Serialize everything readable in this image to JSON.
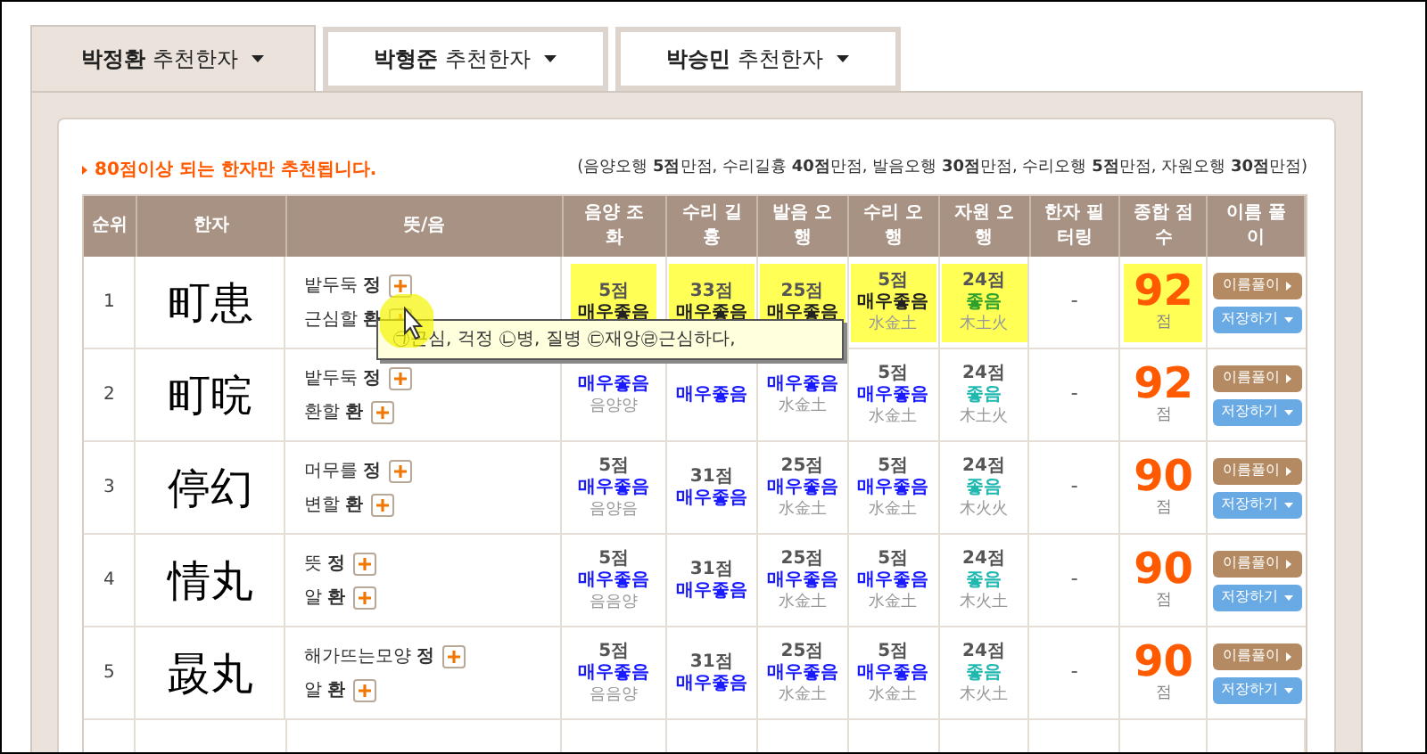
{
  "tabs": [
    {
      "name": "박정환",
      "label": "추천한자",
      "selected": true
    },
    {
      "name": "박형준",
      "label": "추천한자",
      "selected": false
    },
    {
      "name": "박승민",
      "label": "추천한자",
      "selected": false
    }
  ],
  "notice": "80점이상 되는 한자만 추천됩니다.",
  "criteria": "(음양오행 **5점**만점, 수리길흉 **40점**만점, 발음오행 **30점**만점, 수리오행 **5점**만점, 자원오행 **30점**만점)",
  "columns": [
    "순위",
    "한자",
    "뜻/음",
    "음양 조화",
    "수리 길흉",
    "발음 오행",
    "수리 오행",
    "자원 오행",
    "한자 필터링",
    "종합 점수",
    "이름 풀이"
  ],
  "rows": [
    {
      "rank": "1",
      "hanja": "町患",
      "meanings": [
        {
          "meaning": "밭두둑",
          "sound": "정"
        },
        {
          "meaning": "근심할",
          "sound": "환"
        }
      ],
      "highlighted": true,
      "scores": [
        {
          "score": "5점",
          "rating": "매우좋음",
          "kind": "best"
        },
        {
          "score": "33점",
          "rating": "매우좋음",
          "kind": "best"
        },
        {
          "score": "25점",
          "rating": "매우좋음",
          "kind": "best"
        },
        {
          "score": "5점",
          "rating": "매우좋음",
          "kind": "best",
          "sub": "水金土"
        },
        {
          "score": "24점",
          "rating": "좋음",
          "kind": "good",
          "sub": "木土火"
        }
      ],
      "filter": "-",
      "total": "92",
      "unit": "점",
      "buttons": [
        "이름풀이",
        "저장하기"
      ]
    },
    {
      "rank": "2",
      "hanja": "町晥",
      "meanings": [
        {
          "meaning": "밭두둑",
          "sound": "정"
        },
        {
          "meaning": "환할",
          "sound": "환"
        }
      ],
      "highlighted": false,
      "scores": [
        {
          "rating": "매우좋음",
          "kind": "best",
          "sub": "음양양"
        },
        {
          "rating": "매우좋음",
          "kind": "best"
        },
        {
          "rating": "매우좋음",
          "kind": "best",
          "sub": "水金土"
        },
        {
          "score": "5점",
          "rating": "매우좋음",
          "kind": "best",
          "sub": "水金土"
        },
        {
          "score": "24점",
          "rating": "좋음",
          "kind": "good",
          "sub": "木土火"
        }
      ],
      "filter": "-",
      "total": "92",
      "unit": "점",
      "buttons": [
        "이름풀이",
        "저장하기"
      ]
    },
    {
      "rank": "3",
      "hanja": "停幻",
      "meanings": [
        {
          "meaning": "머무를",
          "sound": "정"
        },
        {
          "meaning": "변할",
          "sound": "환"
        }
      ],
      "highlighted": false,
      "scores": [
        {
          "score": "5점",
          "rating": "매우좋음",
          "kind": "best",
          "sub": "음양음"
        },
        {
          "score": "31점",
          "rating": "매우좋음",
          "kind": "best"
        },
        {
          "score": "25점",
          "rating": "매우좋음",
          "kind": "best",
          "sub": "水金土"
        },
        {
          "score": "5점",
          "rating": "매우좋음",
          "kind": "best",
          "sub": "水金土"
        },
        {
          "score": "24점",
          "rating": "좋음",
          "kind": "good",
          "sub": "木火火"
        }
      ],
      "filter": "-",
      "total": "90",
      "unit": "점",
      "buttons": [
        "이름풀이",
        "저장하기"
      ]
    },
    {
      "rank": "4",
      "hanja": "情丸",
      "meanings": [
        {
          "meaning": "뜻",
          "sound": "정"
        },
        {
          "meaning": "알",
          "sound": "환"
        }
      ],
      "highlighted": false,
      "scores": [
        {
          "score": "5점",
          "rating": "매우좋음",
          "kind": "best",
          "sub": "음음양"
        },
        {
          "score": "31점",
          "rating": "매우좋음",
          "kind": "best"
        },
        {
          "score": "25점",
          "rating": "매우좋음",
          "kind": "best",
          "sub": "水金土"
        },
        {
          "score": "5점",
          "rating": "매우좋음",
          "kind": "best",
          "sub": "水金土"
        },
        {
          "score": "24점",
          "rating": "좋음",
          "kind": "good",
          "sub": "木火土"
        }
      ],
      "filter": "-",
      "total": "90",
      "unit": "점",
      "buttons": [
        "이름풀이",
        "저장하기"
      ]
    },
    {
      "rank": "5",
      "hanja": "晸丸",
      "meanings": [
        {
          "meaning": "해가뜨는모양",
          "sound": "정"
        },
        {
          "meaning": "알",
          "sound": "환"
        }
      ],
      "highlighted": false,
      "scores": [
        {
          "score": "5점",
          "rating": "매우좋음",
          "kind": "best",
          "sub": "음음양"
        },
        {
          "score": "31점",
          "rating": "매우좋음",
          "kind": "best"
        },
        {
          "score": "25점",
          "rating": "매우좋음",
          "kind": "best",
          "sub": "水金土"
        },
        {
          "score": "5점",
          "rating": "매우좋음",
          "kind": "best",
          "sub": "水金土"
        },
        {
          "score": "24점",
          "rating": "좋음",
          "kind": "good",
          "sub": "木火土"
        }
      ],
      "filter": "-",
      "total": "90",
      "unit": "점",
      "buttons": [
        "이름풀이",
        "저장하기"
      ]
    }
  ],
  "tooltip": "㉠근심, 걱정 ㉡병, 질병 ㉢재앙㉣근심하다,"
}
